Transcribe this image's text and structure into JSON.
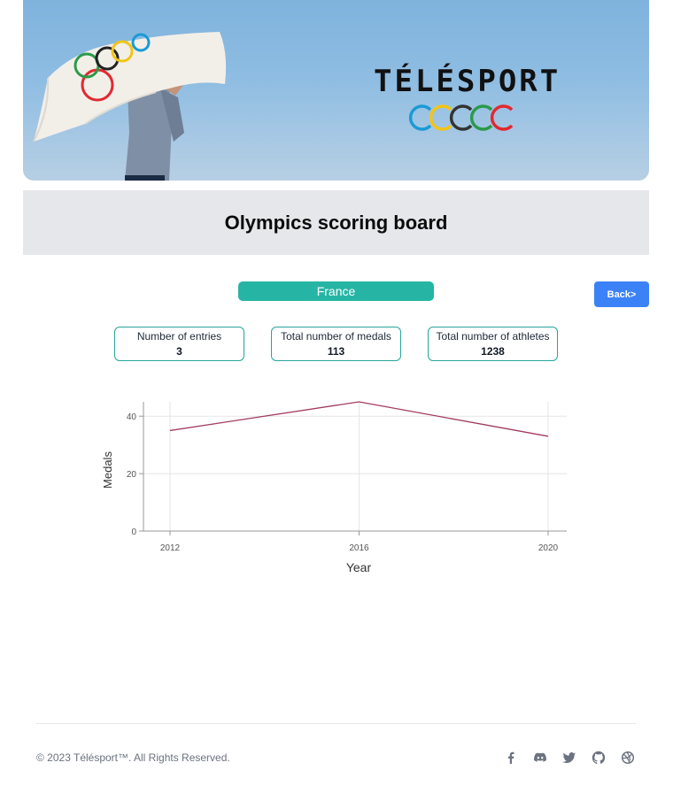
{
  "banner": {
    "brand": "TÉLÉSPORT",
    "ring_colors": [
      "#1a9ad6",
      "#f2c418",
      "#333333",
      "#2b9a4a",
      "#e3282f"
    ]
  },
  "page_title": "Olympics scoring board",
  "country": "France",
  "back_label": "Back>",
  "stats": [
    {
      "label": "Number of entries",
      "value": "3"
    },
    {
      "label": "Total number of medals",
      "value": "113"
    },
    {
      "label": "Total number of athletes",
      "value": "1238"
    }
  ],
  "chart_data": {
    "type": "line",
    "x": [
      "2012",
      "2016",
      "2020"
    ],
    "series": [
      {
        "values": [
          35,
          45,
          33
        ],
        "color": "#a23b5c"
      }
    ],
    "xlabel": "Year",
    "ylabel": "Medals",
    "ylim": [
      0,
      45
    ],
    "yticks": [
      0,
      20,
      40
    ],
    "grid": true
  },
  "footer": {
    "copyright": "© 2023 Télésport™. All Rights Reserved.",
    "socials": [
      "facebook-icon",
      "discord-icon",
      "twitter-icon",
      "github-icon",
      "dribbble-icon"
    ]
  }
}
